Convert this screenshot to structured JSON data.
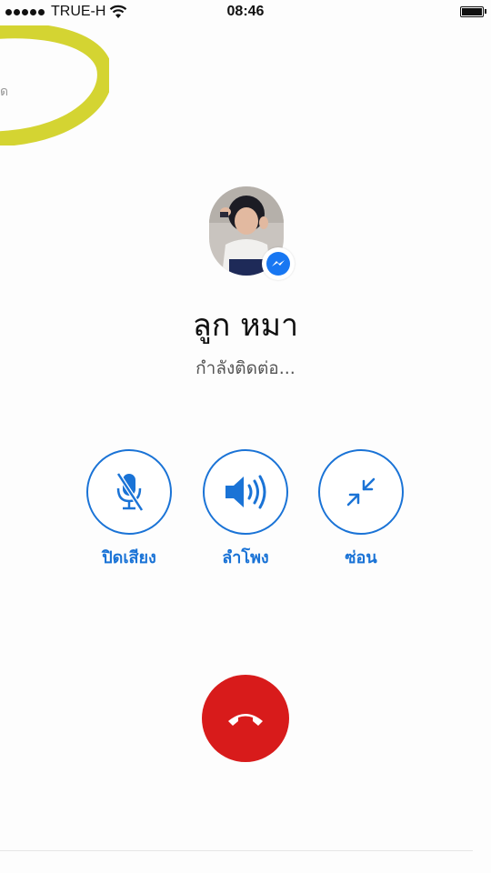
{
  "status_bar": {
    "carrier": "TRUE-H",
    "time": "08:46",
    "signal_bars": 5,
    "icons": [
      "signal-dots-icon",
      "wifi-icon",
      "battery-icon"
    ]
  },
  "annotation": {
    "partial_text": "ด",
    "color": "#d4d432"
  },
  "call": {
    "contact_name": "ลูก หมา",
    "status": "กำลังติดต่อ...",
    "avatar_icon": "profile-photo",
    "badge_icon": "messenger-icon",
    "badge_color": "#1877f2"
  },
  "controls": {
    "mute_label": "ปิดเสียง",
    "mute_icon": "microphone-muted-icon",
    "speaker_label": "ลำโพง",
    "speaker_icon": "speaker-icon",
    "minimize_label": "ซ่อน",
    "minimize_icon": "minimize-arrows-icon",
    "accent_color": "#1a73d6"
  },
  "end_call": {
    "icon": "phone-hangup-icon",
    "color": "#d81b1b"
  }
}
